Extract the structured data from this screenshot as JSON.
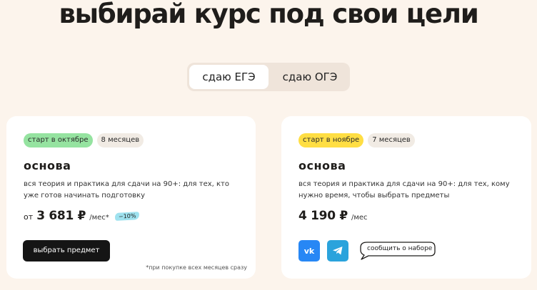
{
  "heading": "выбирай курс под свои цели",
  "tabs": [
    {
      "label": "сдаю ЕГЭ"
    },
    {
      "label": "сдаю ОГЭ"
    }
  ],
  "cards": [
    {
      "badge_start": "старт в октябре",
      "badge_duration": "8 месяцев",
      "title": "основа",
      "description": "вся теория и практика для сдачи на 90+: для тех, кто уже готов начинать подготовку",
      "price_prefix": "от",
      "price": "3 681 ₽",
      "price_unit": "/мес*",
      "discount": "−10%",
      "button_label": "выбрать предмет",
      "footnote": "*при покупке всех месяцев сразу"
    },
    {
      "badge_start": "старт в ноябре",
      "badge_duration": "7 месяцев",
      "title": "основа",
      "description": "вся теория и практика для сдачи на 90+: для тех, кому нужно время, чтобы выбрать предметы",
      "price": "4 190 ₽",
      "price_unit": "/мес",
      "vk_label": "vk",
      "notify_label": "сообщить о наборе"
    }
  ],
  "colors": {
    "page_bg": "#fcf4ec",
    "badge_green": "#95e3a0",
    "badge_yellow": "#ffde43",
    "discount_bg": "#9fe2ef",
    "vk_blue": "#2787f5",
    "telegram_blue": "#2aa3dc"
  },
  "icons": [
    "vk-icon",
    "telegram-icon"
  ]
}
